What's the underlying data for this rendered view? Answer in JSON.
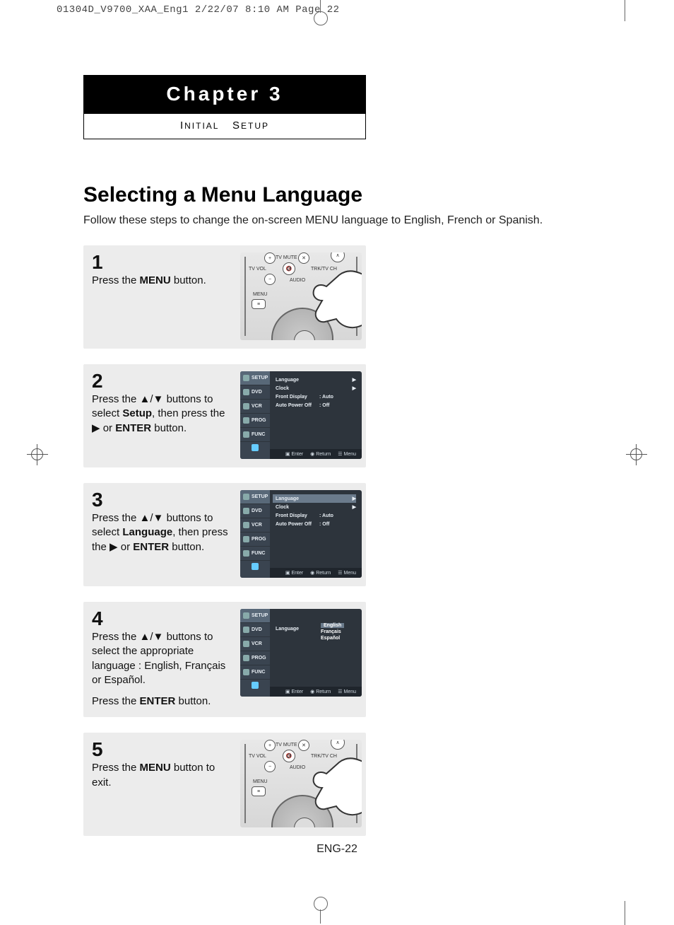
{
  "crop_header": "01304D_V9700_XAA_Eng1  2/22/07  8:10 AM  Page 22",
  "chapter": {
    "title": "Chapter 3",
    "subtitle_1": "I",
    "subtitle_2": "NITIAL",
    "subtitle_3": "S",
    "subtitle_4": "ETUP"
  },
  "section_title": "Selecting a Menu Language",
  "intro": "Follow these steps to change the on-screen MENU language to English, French or Spanish.",
  "remote_labels": {
    "tv_mute": "TV MUTE",
    "tv_vol": "TV VOL",
    "trk": "TRK/TV CH",
    "audio": "AUDIO",
    "menu": "MENU"
  },
  "osd": {
    "side": [
      "SETUP",
      "DVD",
      "VCR",
      "PROG",
      "FUNC"
    ],
    "items": {
      "language": "Language",
      "clock": "Clock",
      "front_display": "Front Display",
      "auto_power_off": "Auto Power Off",
      "auto": ": Auto",
      "off": ": Off"
    },
    "langs": [
      "English",
      "Français",
      "Español"
    ],
    "bar": {
      "enter": "Enter",
      "return": "Return",
      "menu": "Menu"
    },
    "bar_icons": {
      "enter": "▣",
      "return": "◉",
      "menu": "☰"
    }
  },
  "steps": [
    {
      "num": "1",
      "text_pre": "Press the ",
      "bold1": "MENU",
      "text_post": " button.",
      "fig": "remote"
    },
    {
      "num": "2",
      "text_pre": "Press the ",
      "arrows": "▲/▼",
      "text_mid": " buttons to select ",
      "bold1": "Setup",
      "text_mid2": ", then press the ",
      "arrow2": "▶",
      "text_mid3": " or ",
      "bold2": "ENTER",
      "text_post": " button.",
      "fig": "osd-setup"
    },
    {
      "num": "3",
      "text_pre": "Press the ",
      "arrows": "▲/▼",
      "text_mid": " buttons to select ",
      "bold1": "Language",
      "text_mid2": ", then press the ",
      "arrow2": "▶",
      "text_mid3": " or ",
      "bold2": "ENTER",
      "text_post": " button.",
      "fig": "osd-lang-hl"
    },
    {
      "num": "4",
      "text_pre": "Press the ",
      "arrows": "▲/▼",
      "text_mid": " buttons to select the appropriate language : English, Français or Español.",
      "line2_pre": "Press the ",
      "line2_bold": "ENTER",
      "line2_post": " button.",
      "fig": "osd-lang-list"
    },
    {
      "num": "5",
      "text_pre": "Press the ",
      "bold1": "MENU",
      "text_post": " button to exit.",
      "fig": "remote"
    }
  ],
  "page_number": "ENG-22"
}
